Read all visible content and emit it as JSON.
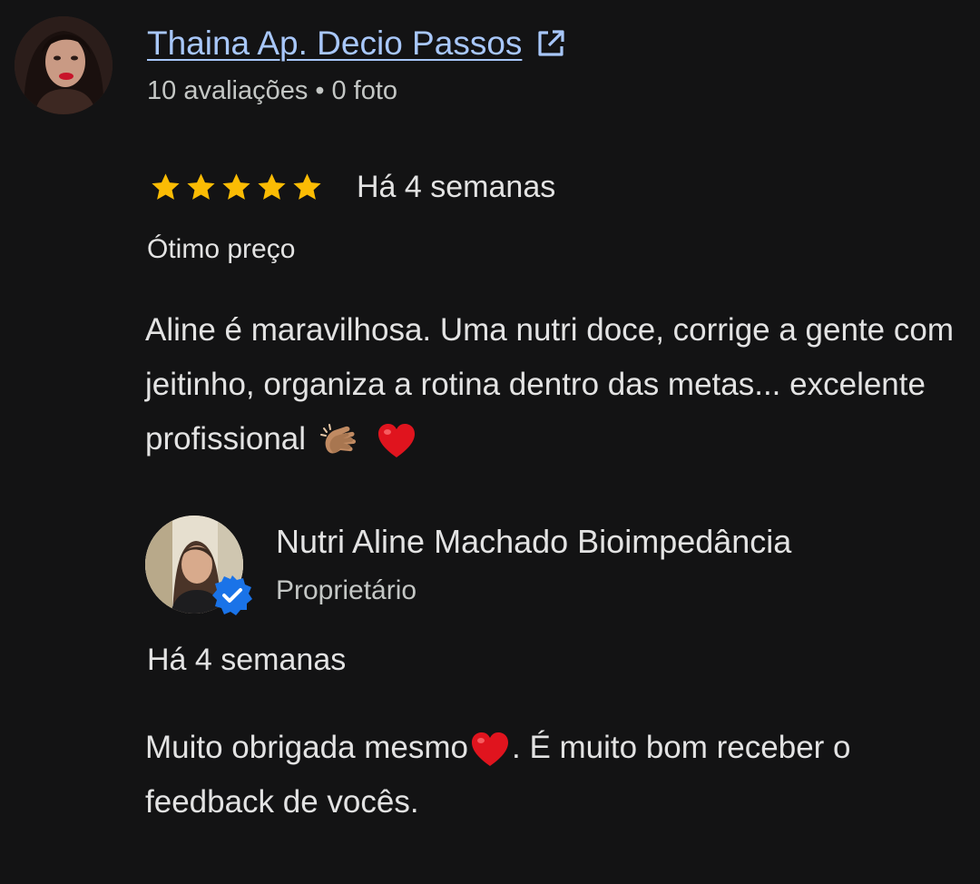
{
  "review": {
    "reviewer_name": "Thaina Ap. Decio Passos",
    "reviewer_reviews": "10 avaliações",
    "reviewer_photos": "0 foto",
    "meta_separator": "•",
    "rating": 5,
    "rating_max": 5,
    "date": "Há 4 semanas",
    "tag": "Ótimo preço",
    "text": "Aline é maravilhosa. Uma nutri doce, corrige a gente com jeitinho, organiza a rotina dentro das metas... excelente profissional",
    "emojis": [
      "clapping-hands",
      "red-heart"
    ]
  },
  "owner_reply": {
    "name": "Nutri Aline Machado Bioimpedância",
    "role": "Proprietário",
    "date": "Há 4 semanas",
    "text_part1": "Muito obrigada mesmo",
    "text_part2": ". É muito bom receber o feedback de vocês."
  },
  "colors": {
    "background": "#131314",
    "link": "#a8c7fa",
    "star": "#fbbc04",
    "verified": "#1a73e8",
    "text": "#e3e3e3",
    "secondary_text": "#c4c7c5"
  },
  "icons": [
    "external-link-icon",
    "star-icon",
    "verified-badge-icon"
  ]
}
